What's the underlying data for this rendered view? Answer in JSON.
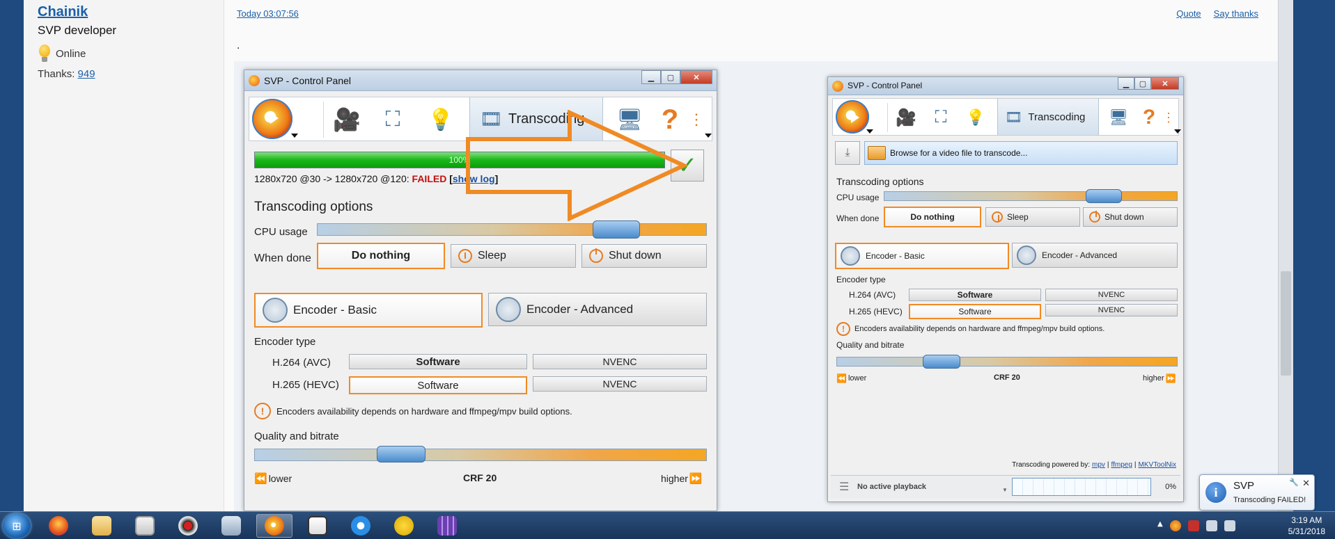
{
  "author": {
    "name": "Chainik",
    "role": "SVP developer",
    "status": "Online",
    "thanks_label": "Thanks:",
    "thanks_count": "949"
  },
  "post": {
    "timestamp": "Today 03:07:56",
    "quote": "Quote",
    "say_thanks": "Say thanks",
    "body_dot": "."
  },
  "svp_big": {
    "title": "SVP - Control Panel",
    "tab_active": "Transcoding",
    "progress_pct": 100,
    "progress_label": "100%",
    "job_info": "1280x720 @30 -> 1280x720 @120:",
    "job_status": "FAILED",
    "show_log_open": "[",
    "show_log": "show log",
    "show_log_close": "]",
    "options_title": "Transcoding options",
    "cpu_label": "CPU usage",
    "cpu_level": 0.82,
    "when_done_label": "When done",
    "when_done_options": [
      "Do nothing",
      "Sleep",
      "Shut down"
    ],
    "encoder_basic": "Encoder - Basic",
    "encoder_advanced": "Encoder - Advanced",
    "encoder_type_label": "Encoder type",
    "h264_label": "H.264 (AVC)",
    "h265_label": "H.265 (HEVC)",
    "software": "Software",
    "nvenc": "NVENC",
    "encoders_note": "Encoders availability depends on hardware and ffmpeg/mpv build options.",
    "quality_label": "Quality and bitrate",
    "quality_level": 0.32,
    "lower": "lower",
    "crf": "CRF 20",
    "higher": "higher"
  },
  "svp_small": {
    "title": "SVP - Control Panel",
    "tab_active": "Transcoding",
    "browse": "Browse for a video file to transcode...",
    "options_title": "Transcoding options",
    "cpu_label": "CPU usage",
    "cpu_level": 0.65,
    "when_done_label": "When done",
    "when_done_options": [
      "Do nothing",
      "Sleep",
      "Shut down"
    ],
    "encoder_basic": "Encoder - Basic",
    "encoder_advanced": "Encoder - Advanced",
    "encoder_type_label": "Encoder type",
    "h264_label": "H.264 (AVC)",
    "h265_label": "H.265 (HEVC)",
    "software": "Software",
    "nvenc": "NVENC",
    "encoders_note": "Encoders availability depends on hardware and ffmpeg/mpv build options.",
    "quality_label": "Quality and bitrate",
    "quality_level": 0.31,
    "lower": "lower",
    "crf": "CRF 20",
    "higher": "higher",
    "powered_by": "Transcoding powered by:",
    "mpv": "mpv",
    "ffmpeg": "ffmpeg",
    "mkvtoolnix": "MKVToolNix",
    "sep": "|",
    "no_playback": "No active playback",
    "load_pct": "0%"
  },
  "taskbar": {
    "time": "3:19 AM",
    "date": "5/31/2018"
  },
  "notification": {
    "title": "SVP",
    "message": "Transcoding FAILED!",
    "close": "✕"
  },
  "colors": {
    "accent_orange": "#f08a24",
    "failed_red": "#c01010",
    "link_blue": "#1a5fa8"
  }
}
